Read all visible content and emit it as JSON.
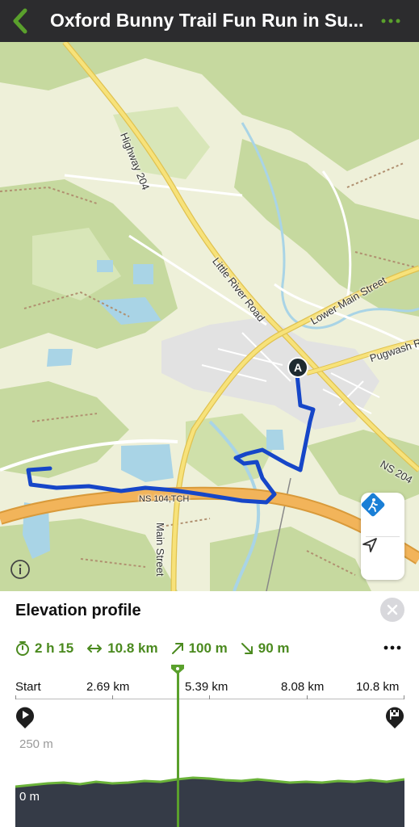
{
  "header": {
    "title": "Oxford Bunny Trail Fun Run in Su...",
    "back_icon": "chevron-left-icon",
    "more_icon": "more-horizontal-icon"
  },
  "map": {
    "labels": {
      "highway_204": "Highway 204",
      "little_river_road": "Little River Road",
      "lower_main_street": "Lower Main Street",
      "pugwash": "Pugwash R",
      "ns204": "NS 204",
      "ns104": "NS 104;TCH",
      "main_street": "Main Street"
    },
    "start_marker": "A",
    "route_color": "#1646c8",
    "controls": {
      "activity_icon": "hiking-icon",
      "locate_icon": "location-arrow-icon",
      "info_icon": "info-icon"
    }
  },
  "elevation": {
    "title": "Elevation profile",
    "close_icon": "close-icon",
    "stats": {
      "duration": "2 h 15",
      "distance": "10.8 km",
      "ascent": "100 m",
      "descent": "90 m"
    },
    "axis": {
      "start": "Start",
      "t1": "2.69 km",
      "t2": "5.39 km",
      "t3": "8.08 km",
      "t4": "10.8 km"
    },
    "y_labels": {
      "top": "250 m",
      "bottom": "0 m"
    },
    "accent_color": "#5aa02c",
    "scrubber_fraction": 0.41
  }
}
